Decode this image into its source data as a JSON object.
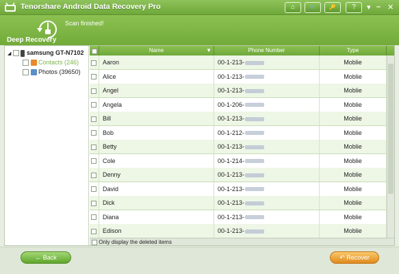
{
  "window": {
    "title": "Tenorshare Android Data Recovery Pro"
  },
  "toolbar": {
    "home_glyph": "⌂",
    "cart_glyph": "🛒",
    "key_glyph": "🔑",
    "help_glyph": "?",
    "dropdown_glyph": "▾",
    "minimize_glyph": "–",
    "close_glyph": "✕"
  },
  "header": {
    "mode_label": "Deep Recovery",
    "scan_status": "Scan finished!"
  },
  "tree": {
    "device": "samsung GT-N7102",
    "items": [
      {
        "label": "Contacts (246)",
        "selected": true
      },
      {
        "label": "Photos (39650)",
        "selected": false
      }
    ]
  },
  "table": {
    "columns": [
      "Name",
      "Phone Number",
      "Type"
    ],
    "rows": [
      {
        "name": "Aaron",
        "phone": "00-1-213-",
        "type": "Moblie"
      },
      {
        "name": "Alice",
        "phone": "00-1-213-",
        "type": "Moblie"
      },
      {
        "name": "Angel",
        "phone": "00-1-213-",
        "type": "Moblie"
      },
      {
        "name": "Angela",
        "phone": "00-1-206-",
        "type": "Moblie"
      },
      {
        "name": "Bill",
        "phone": "00-1-213-",
        "type": "Moblie"
      },
      {
        "name": "Bob",
        "phone": "00-1-212-",
        "type": "Moblie"
      },
      {
        "name": "Betty",
        "phone": "00-1-213-",
        "type": "Moblie"
      },
      {
        "name": "Cole",
        "phone": "00-1-214-",
        "type": "Moblie"
      },
      {
        "name": "Denny",
        "phone": "00-1-213-",
        "type": "Moblie"
      },
      {
        "name": "David",
        "phone": "00-1-213-",
        "type": "Moblie"
      },
      {
        "name": "Dick",
        "phone": "00-1-213-",
        "type": "Moblie"
      },
      {
        "name": "Diana",
        "phone": "00-1-213-",
        "type": "Moblie"
      },
      {
        "name": "Edison",
        "phone": "00-1-213-",
        "type": "Moblie"
      }
    ],
    "footer_checkbox_label": "Only display the deleted items"
  },
  "buttons": {
    "back": "Back",
    "back_glyph": "←",
    "recover": "Recover",
    "recover_glyph": "↶"
  },
  "colors": {
    "brand_green": "#7db446",
    "row_alt": "#eef6e6",
    "recover_orange": "#f0a23a"
  }
}
